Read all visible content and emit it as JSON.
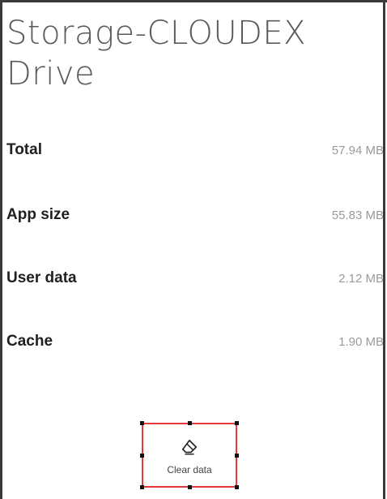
{
  "app_title": "Storage-CLOUDEX Drive",
  "storage_rows": [
    {
      "label": "Total",
      "value": "57.94 MB"
    },
    {
      "label": "App size",
      "value": "55.83 MB"
    },
    {
      "label": "User data",
      "value": "2.12 MB"
    },
    {
      "label": "Cache",
      "value": "1.90 MB"
    }
  ],
  "clear_button": {
    "label": "Clear data",
    "icon": "eraser-icon",
    "highlight_color": "#e83a3a"
  }
}
